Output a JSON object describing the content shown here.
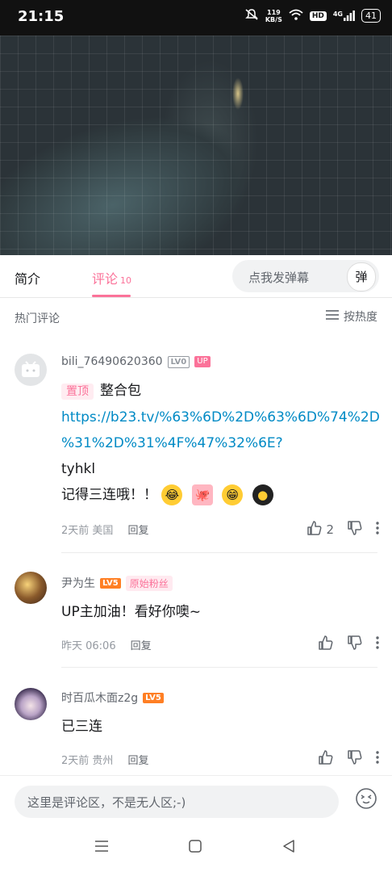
{
  "status_bar": {
    "time": "21:15",
    "net_speed_value": "119",
    "net_speed_unit": "KB/S",
    "hd": "HD",
    "network": "4G",
    "battery": "41"
  },
  "tabs": {
    "intro": "简介",
    "comments": "评论",
    "comments_count": "10"
  },
  "danmaku": {
    "placeholder": "点我发弹幕",
    "toggle_label": "弹"
  },
  "hot_header": {
    "title": "热门评论",
    "sort_label": "按热度"
  },
  "comments": [
    {
      "username": "bili_76490620360",
      "level": "LV0",
      "badge": "UP",
      "pin": "置顶",
      "line1": "整合包",
      "link1": "https://b23.tv/%63%6D%2D%63%6D%74%2D",
      "link2": "%31%2D%31%4F%47%32%6E?",
      "line3": "tyhkl",
      "line4": "记得三连哦！！",
      "time": "2天前",
      "location": "美国",
      "reply": "回复",
      "likes": "2"
    },
    {
      "username": "尹为生",
      "level": "LV5",
      "badge": "原始粉丝",
      "text": "UP主加油！看好你噢~",
      "time": "昨天 06:06",
      "reply": "回复"
    },
    {
      "username": "时百瓜木面z2g",
      "level": "LV5",
      "text": "已三连",
      "time": "2天前",
      "location": "贵州",
      "reply": "回复"
    }
  ],
  "comment_input": {
    "placeholder": "这里是评论区，不是无人区;-)"
  },
  "colors": {
    "accent": "#fb7299",
    "link": "#008ac5",
    "level_orange": "#ff7f24"
  }
}
